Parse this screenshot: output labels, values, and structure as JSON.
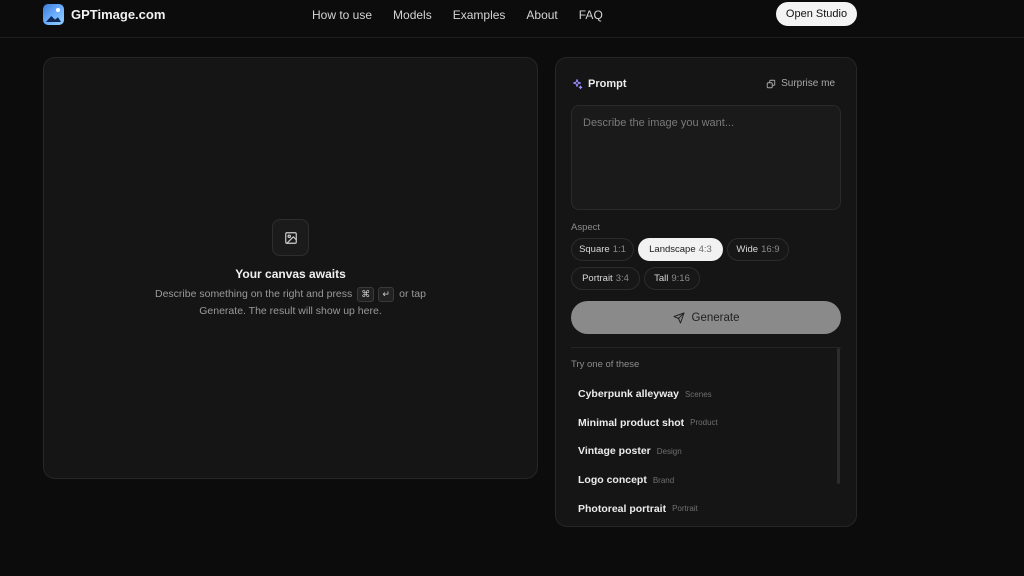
{
  "header": {
    "brand": "GPTimage.com",
    "nav": [
      "How to use",
      "Models",
      "Examples",
      "About",
      "FAQ"
    ],
    "cta": "Open Studio"
  },
  "canvas": {
    "icon": "image-icon",
    "title": "Your canvas awaits",
    "desc_part1": "Describe something on the right and press",
    "key1": "⌘",
    "key2": "↵",
    "desc_part2": "or tap",
    "desc_line2": "Generate. The result will show up here."
  },
  "panel": {
    "prompt_label": "Prompt",
    "surprise_label": "Surprise me",
    "prompt_placeholder": "Describe the image you want...",
    "prompt_value": "",
    "aspect_label": "Aspect",
    "aspects": [
      {
        "name": "Square",
        "ratio": "1:1",
        "active": false
      },
      {
        "name": "Landscape",
        "ratio": "4:3",
        "active": true
      },
      {
        "name": "Wide",
        "ratio": "16:9",
        "active": false
      },
      {
        "name": "Portrait",
        "ratio": "3:4",
        "active": false
      },
      {
        "name": "Tall",
        "ratio": "9:16",
        "active": false
      }
    ],
    "generate_label": "Generate",
    "try_label": "Try one of these",
    "suggestions": [
      {
        "title": "Cyberpunk alleyway",
        "tag": "Scenes"
      },
      {
        "title": "Minimal product shot",
        "tag": "Product"
      },
      {
        "title": "Vintage poster",
        "tag": "Design"
      },
      {
        "title": "Logo concept",
        "tag": "Brand"
      },
      {
        "title": "Photoreal portrait",
        "tag": "Portrait"
      }
    ]
  },
  "colors": {
    "background": "#0c0c0c",
    "panel": "#151515",
    "active_chip": "#f2f2f2",
    "generate_button": "#8a8a8a"
  }
}
